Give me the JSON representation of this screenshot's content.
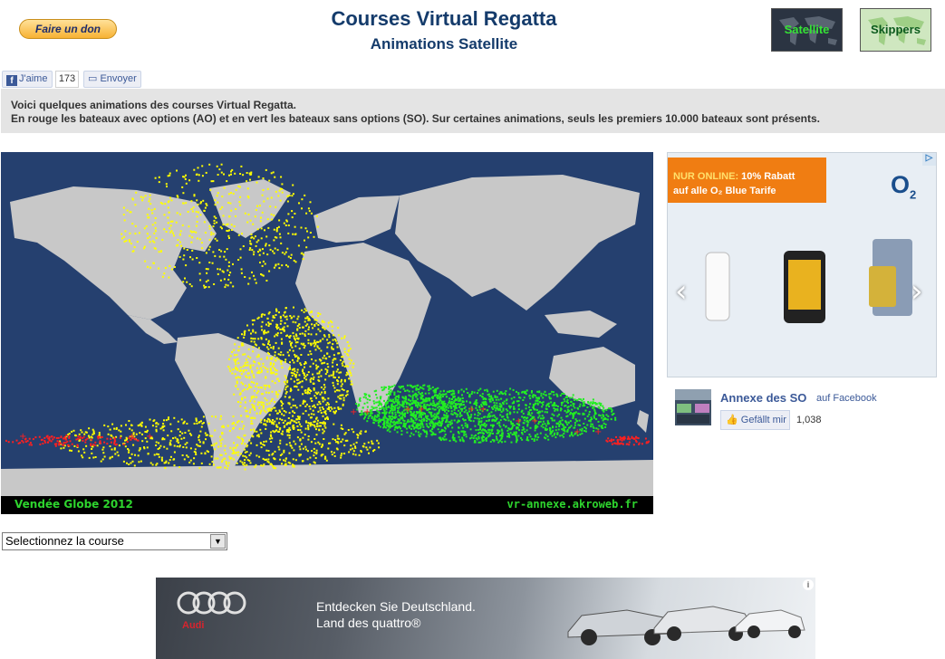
{
  "header": {
    "donate_label": "Faire un don",
    "title": "Courses Virtual Regatta",
    "subtitle": "Animations Satellite",
    "satellite_label": "Satellite",
    "skippers_label": "Skippers"
  },
  "social": {
    "like_label": "J'aime",
    "like_count": "173",
    "send_label": "Envoyer"
  },
  "info": {
    "line1": "Voici quelques animations des courses Virtual Regatta.",
    "line2": "En rouge les bateaux avec options (AO) et en vert les bateaux sans options (SO). Sur certaines animations, seuls les premiers 10.000 bateaux sont présents."
  },
  "map": {
    "race_label": "Vendée Globe 2012",
    "site_label": "vr-annexe.akroweb.fr",
    "colors": {
      "ocean": "#25406f",
      "land": "#c8c8c8",
      "ao": "#ffff00",
      "so": "#22ee22",
      "marker": "#ff2020"
    }
  },
  "ad_right": {
    "line1_highlight": "NUR ONLINE:",
    "line1_rest": " 10% Rabatt",
    "line2": "auf alle O₂ Blue Tarife",
    "brand": "O",
    "brand_sub": "2",
    "prev_icon": "‹",
    "next_icon": "›"
  },
  "fb_page": {
    "name": "Annexe des SO",
    "suffix": "auf Facebook",
    "like_label": "Gefällt mir",
    "count": "1,038"
  },
  "course_select": {
    "selected": "Selectionnez la course"
  },
  "ad_bottom": {
    "brand": "Audi",
    "line1": "Entdecken Sie Deutschland.",
    "line2": "Land des quattro®"
  }
}
